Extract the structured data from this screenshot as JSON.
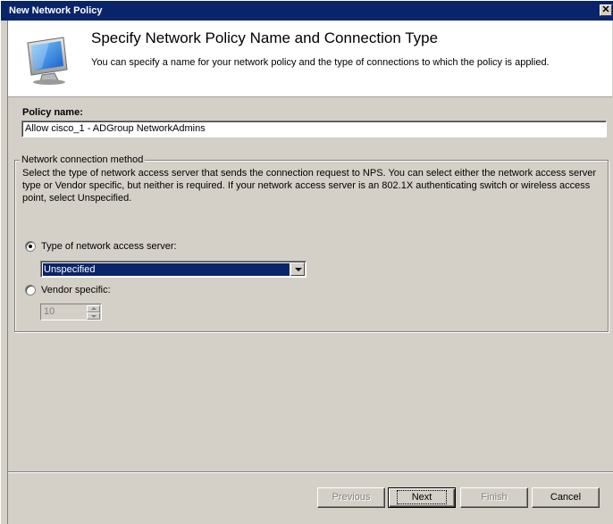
{
  "window": {
    "title": "New Network Policy",
    "close_glyph": "✕"
  },
  "header": {
    "title": "Specify Network Policy Name and Connection Type",
    "subtitle": "You can specify a name for your network policy and the type of connections to which the policy is applied.",
    "icon": "monitor-network-icon"
  },
  "policy": {
    "label": "Policy name:",
    "value": "Allow cisco_1 - ADGroup NetworkAdmins"
  },
  "connection_method": {
    "legend": "Network connection method",
    "description": "Select the type of network access server that sends the connection request to NPS. You can select either the network access server type or Vendor specific, but neither is required.  If your network access server is an 802.1X authenticating switch or wireless access point, select Unspecified.",
    "type_option_label": "Type of network access server:",
    "type_option_checked": true,
    "type_selected": "Unspecified",
    "vendor_option_label": "Vendor specific:",
    "vendor_option_checked": false,
    "vendor_value": "10"
  },
  "buttons": {
    "previous": "Previous",
    "next": "Next",
    "finish": "Finish",
    "cancel": "Cancel"
  },
  "colors": {
    "titlebar": "#0a246a",
    "face": "#d4d0c8",
    "selection": "#0a246a"
  }
}
